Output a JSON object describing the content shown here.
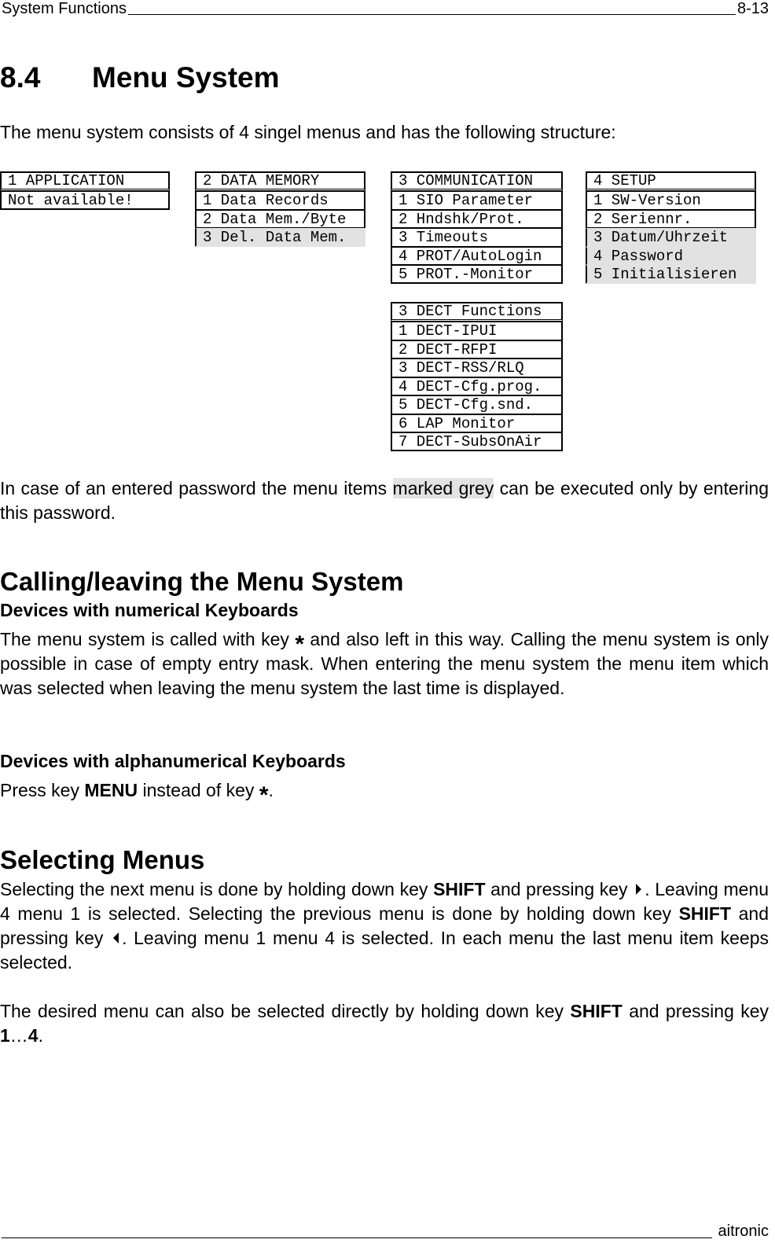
{
  "header": {
    "section": "System Functions",
    "page": "8-13"
  },
  "footer": {
    "company": "aitronic"
  },
  "title": {
    "number": "8.4",
    "text": "Menu System"
  },
  "intro": "The menu system consists of 4 singel menus and has the following structure:",
  "menus": [
    {
      "title": "1 APPLICATION",
      "items": [
        {
          "label": "Not available!",
          "grey": false
        }
      ]
    },
    {
      "title": "2 DATA MEMORY",
      "items": [
        {
          "label": "1 Data Records",
          "grey": false
        },
        {
          "label": "2 Data Mem./Byte",
          "grey": false
        },
        {
          "label": "3 Del. Data Mem.",
          "grey": true
        }
      ]
    },
    {
      "title": "3 COMMUNICATION",
      "items": [
        {
          "label": "1 SIO Parameter",
          "grey": false
        },
        {
          "label": "2 Hndshk/Prot.",
          "grey": false
        },
        {
          "label": "3 Timeouts",
          "grey": false
        },
        {
          "label": "4 PROT/AutoLogin",
          "grey": false
        },
        {
          "label": "5 PROT.-Monitor",
          "grey": false
        }
      ]
    },
    {
      "title": "4 SETUP",
      "items": [
        {
          "label": "1 SW-Version",
          "grey": false
        },
        {
          "label": "2 Seriennr.",
          "grey": false
        },
        {
          "label": "3 Datum/Uhrzeit",
          "grey": true
        },
        {
          "label": "4 Password",
          "grey": true
        },
        {
          "label": "5 Initialisieren",
          "grey": true
        }
      ]
    },
    {
      "title": "3 DECT Functions",
      "items": [
        {
          "label": "1 DECT-IPUI",
          "grey": false
        },
        {
          "label": "2 DECT-RFPI",
          "grey": false
        },
        {
          "label": "3 DECT-RSS/RLQ",
          "grey": false
        },
        {
          "label": "4 DECT-Cfg.prog.",
          "grey": false
        },
        {
          "label": "5 DECT-Cfg.snd.",
          "grey": false
        },
        {
          "label": "6 LAP Monitor",
          "grey": false
        },
        {
          "label": "7 DECT-SubsOnAir",
          "grey": false
        }
      ]
    }
  ],
  "password_note": {
    "before": "In case of an entered password the menu items ",
    "highlight": "marked grey",
    "after": " can be executed only by entering this password."
  },
  "calling": {
    "heading": "Calling/leaving the Menu System",
    "numerical_heading": "Devices with numerical Keyboards",
    "numerical_before": "The menu system is called with key ",
    "star": "*",
    "numerical_after": " and also left in this way. Calling the menu system is only possible in case of empty entry mask. When entering the menu system the menu item which was selected when leaving the menu system the last time is displayed.",
    "alpha_heading": "Devices with alphanumerical Keyboards",
    "alpha_before": "Press key ",
    "alpha_key": "MENU",
    "alpha_mid": " instead of key ",
    "alpha_after": "."
  },
  "selecting": {
    "heading": "Selecting Menus",
    "p1_a": "Selecting the next menu is done by holding down key ",
    "shift": "SHIFT",
    "p1_b": " and pressing key ",
    "p1_c": ". Leaving menu 4 menu 1 is selected. Selecting the previous menu is done by holding down key ",
    "p1_d": " and pressing key ",
    "p1_e": ". Leaving menu 1 menu 4 is selected. In each menu the last menu item keeps selected.",
    "p2_a": "The desired menu can also be selected directly by holding down key ",
    "p2_b": " and pressing key ",
    "key_first": "1",
    "ellipsis": "…",
    "key_last": "4",
    "p2_c": "."
  }
}
